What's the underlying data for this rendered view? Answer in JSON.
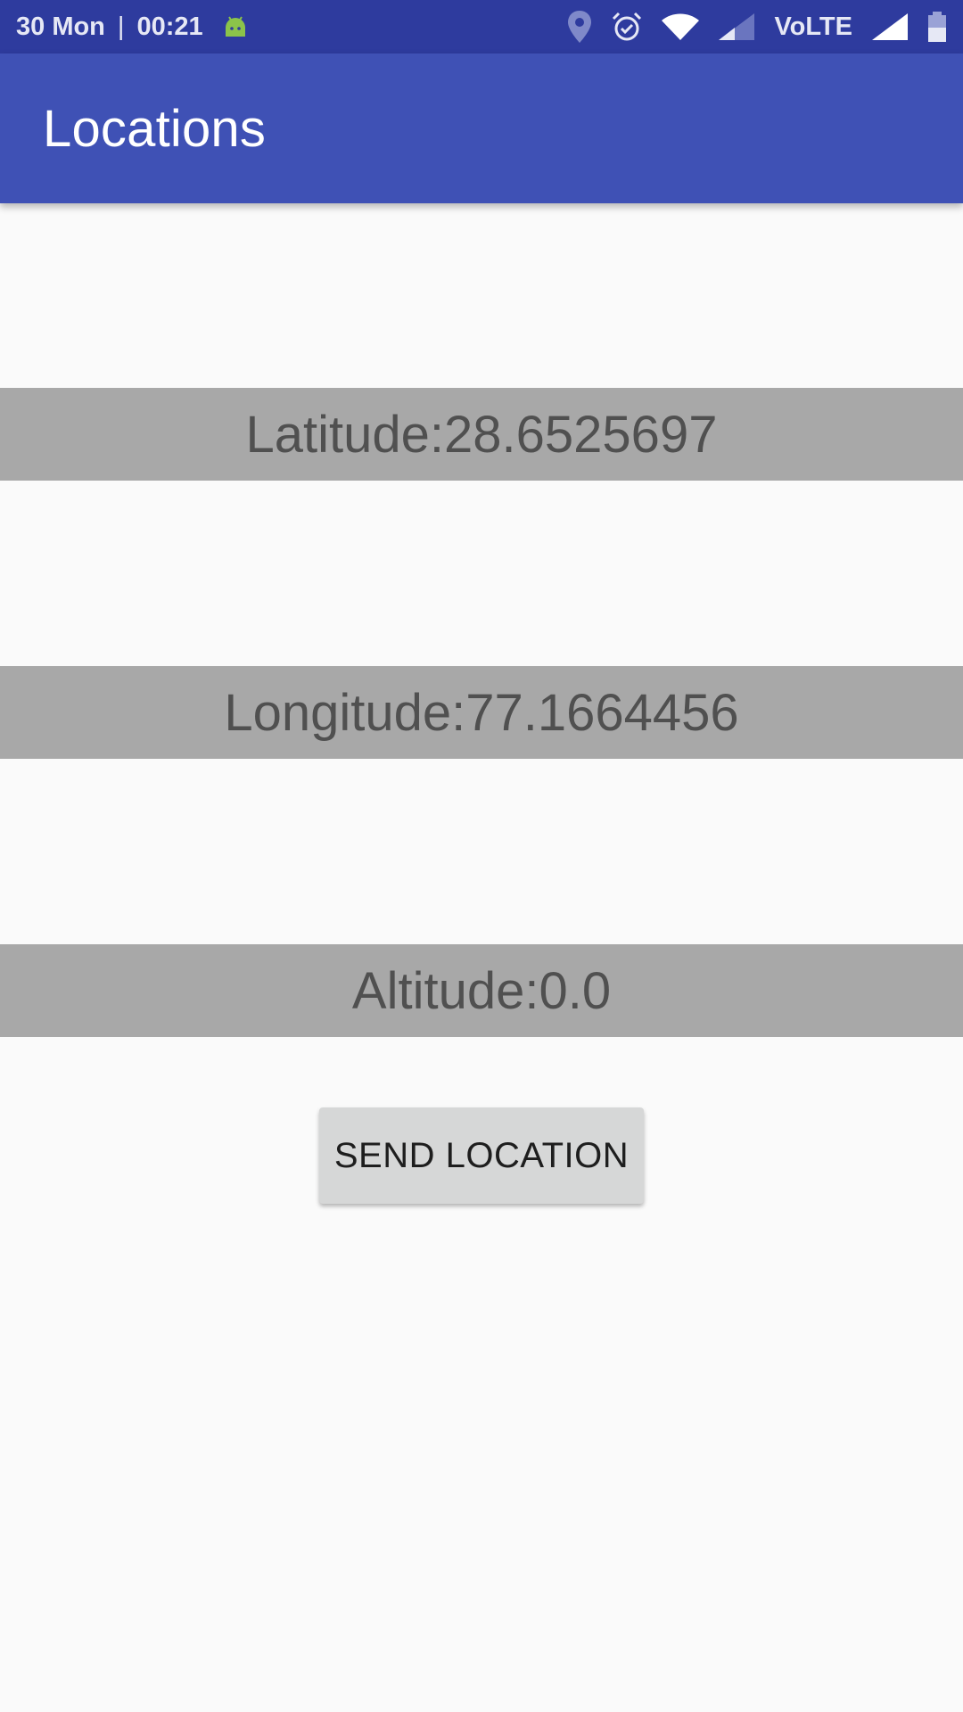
{
  "status_bar": {
    "date": "30 Mon",
    "separator": "|",
    "time": "00:21",
    "network_label": "VoLTE",
    "icons": {
      "notification": "android-icon",
      "location": "location-pin-icon",
      "alarm": "alarm-icon",
      "wifi": "wifi-icon",
      "signal_1": "signal-weak-icon",
      "signal_2": "signal-full-icon",
      "battery": "battery-icon"
    }
  },
  "app_bar": {
    "title": "Locations"
  },
  "location": {
    "latitude_text": "Latitude:28.6525697",
    "longitude_text": "Longitude:77.1664456",
    "altitude_text": "Altitude:0.0"
  },
  "actions": {
    "send_label": "SEND LOCATION"
  },
  "colors": {
    "status_bar": "#2e3b9e",
    "app_bar": "#3f51b5",
    "band": "#a8a8a8",
    "band_text": "#505050",
    "background": "#fafafa",
    "button": "#d6d7d7",
    "android_icon": "#8bc34a"
  }
}
